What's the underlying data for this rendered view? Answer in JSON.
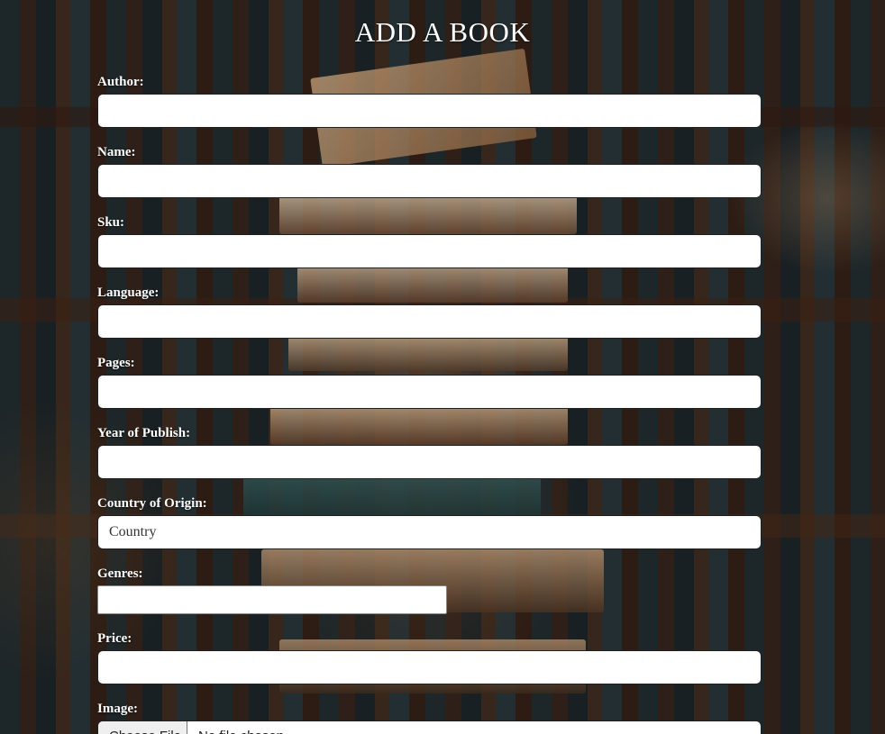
{
  "page": {
    "title": "ADD A BOOK"
  },
  "form": {
    "author": {
      "label": "Author:",
      "value": ""
    },
    "name": {
      "label": "Name:",
      "value": ""
    },
    "sku": {
      "label": "Sku:",
      "value": ""
    },
    "language": {
      "label": "Language:",
      "value": ""
    },
    "pages": {
      "label": "Pages:",
      "value": ""
    },
    "year_of_publish": {
      "label": "Year of Publish:",
      "value": ""
    },
    "country_of_origin": {
      "label": "Country of Origin:",
      "placeholder": "Country"
    },
    "genres": {
      "label": "Genres:"
    },
    "price": {
      "label": "Price:",
      "value": ""
    },
    "image": {
      "label": "Image:",
      "button_label": "Choose File",
      "status": "No file chosen"
    }
  },
  "colors": {
    "label_text": "#ffffff",
    "input_background": "#ffffff",
    "input_border": "#222222"
  }
}
